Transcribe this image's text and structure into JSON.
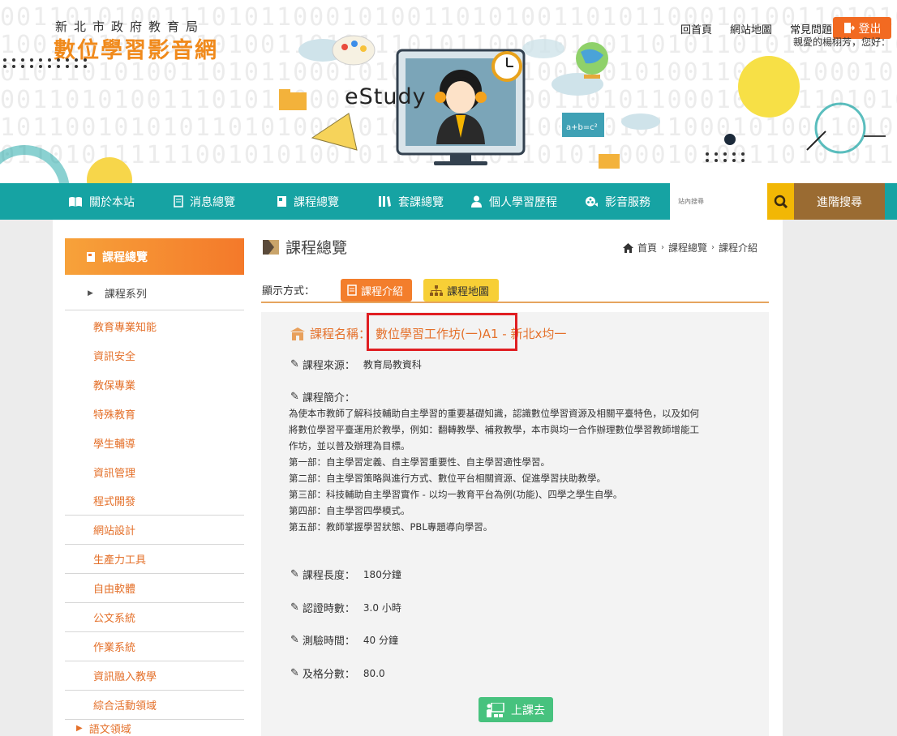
{
  "header": {
    "logo_sub": "新北市政府教育局",
    "logo_main": "數位學習影音網",
    "banner_text": "eStudy",
    "top_links": [
      "回首頁",
      "網站地圖",
      "常見問題"
    ],
    "logout_label": "登出",
    "greeting": "親愛的楊栩芳，您好："
  },
  "nav": {
    "items": [
      {
        "label": "關於本站",
        "icon": "book-icon"
      },
      {
        "label": "消息總覽",
        "icon": "document-icon"
      },
      {
        "label": "課程總覽",
        "icon": "notebook-icon"
      },
      {
        "label": "套課總覽",
        "icon": "library-icon"
      },
      {
        "label": "個人學習歷程",
        "icon": "person-icon"
      },
      {
        "label": "影音服務",
        "icon": "film-reel-icon"
      }
    ],
    "search_placeholder": "站內搜尋",
    "advanced_search": "進階搜尋"
  },
  "sidebar": {
    "header": "課程總覽",
    "series_label": "課程系列",
    "items": [
      "教育專業知能",
      "資訊安全",
      "教保專業",
      "特殊教育",
      "學生輔導",
      "資訊管理",
      "程式開發",
      "網站設計",
      "生產力工具",
      "自由軟體",
      "公文系統",
      "作業系統",
      "資訊融入教學",
      "綜合活動領域"
    ],
    "next_item": "語文領域"
  },
  "main": {
    "title": "課程總覽",
    "breadcrumb": [
      "首頁",
      "課程總覽",
      "課程介紹"
    ],
    "display_label": "顯示方式：",
    "tabs": [
      "課程介紹",
      "課程地圖"
    ],
    "course": {
      "name_label": "課程名稱：",
      "name_value": "數位學習工作坊(一)A1 - 新北x均一",
      "source_label": "課程來源：",
      "source_value": "教育局教資科",
      "intro_label": "課程簡介：",
      "intro_lines": [
        "為使本市教師了解科技輔助自主學習的重要基礎知識，認識數位學習資源及相關平臺特色，以及如何",
        "將數位學習平臺運用於教學，例如：翻轉教學、補救教學，本市與均一合作辦理數位學習教師增能工",
        "作坊，並以普及辦理為目標。",
        "第一部：自主學習定義、自主學習重要性、自主學習適性學習。",
        "第二部：自主學習策略與進行方式、數位平台相關資源、促進學習扶助教學。",
        "第三部：科技輔助自主學習實作 - 以均一教育平台為例(功能)、四學之學生自學。",
        "第四部：自主學習四學模式。",
        "第五部：教師掌握學習狀態、PBL專題導向學習。"
      ],
      "length_label": "課程長度：",
      "length_value": "180分鐘",
      "cert_label": "認證時數：",
      "cert_value": "3.0 小時",
      "test_label": "測驗時間：",
      "test_value": "40 分鐘",
      "pass_label": "及格分數：",
      "pass_value": "80.0"
    },
    "go_button": "上課去"
  },
  "colors": {
    "nav_teal": "#16a3a3",
    "accent_orange": "#f37e2c",
    "search_yellow": "#f2b705",
    "advanced_brown": "#9a6b32",
    "highlight_red": "#e01e22",
    "go_green": "#47c27e"
  }
}
